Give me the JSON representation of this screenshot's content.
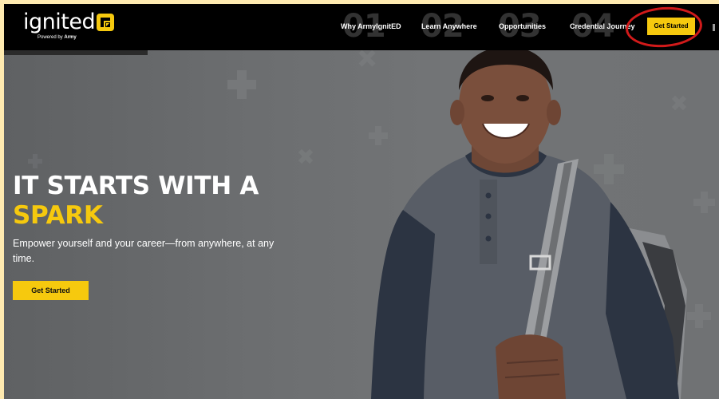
{
  "brand": {
    "name": "ignited",
    "tagline_prefix": "Powered by",
    "tagline_strong": "Army",
    "logo_icon": "ignited-badge-icon"
  },
  "nav": {
    "background_numbers": [
      "01",
      "02",
      "03",
      "04"
    ],
    "links": [
      {
        "label": "Why ArmyIgnitED"
      },
      {
        "label": "Learn Anywhere"
      },
      {
        "label": "Opportunities"
      },
      {
        "label": "Credential Journey"
      }
    ],
    "cta": "Get Started"
  },
  "hero": {
    "title": "IT STARTS WITH A",
    "accent": "SPARK",
    "subtitle": "Empower yourself and your career—from anywhere, at any time.",
    "cta": "Get Started"
  },
  "colors": {
    "brand_yellow": "#f6c90e",
    "nav_background": "#000000",
    "hero_background": "#6b6d6f",
    "annotation_red": "#d11a1a",
    "page_border": "#ffeab0"
  }
}
